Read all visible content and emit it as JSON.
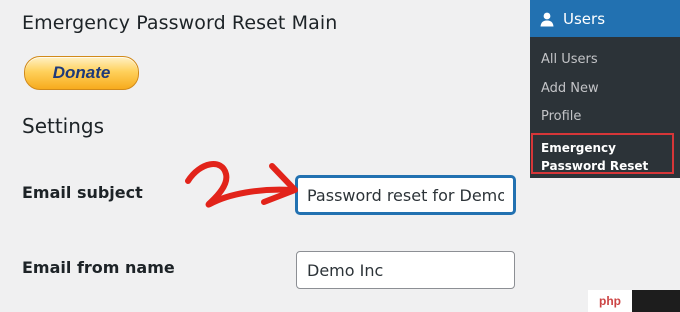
{
  "page": {
    "title": "Emergency Password Reset Main",
    "donate_label": "Donate",
    "settings_heading": "Settings"
  },
  "fields": {
    "email_subject": {
      "label": "Email subject",
      "value": "Password reset for Demo"
    },
    "email_from_name": {
      "label": "Email from name",
      "value": "Demo Inc"
    }
  },
  "sidebar": {
    "menu_title": "Users",
    "menu_icon": "user-icon",
    "items": [
      {
        "label": "All Users"
      },
      {
        "label": "Add New"
      },
      {
        "label": "Profile"
      },
      {
        "label": "Emergency Password Reset",
        "active": true
      }
    ]
  },
  "annotation": {
    "arrow_color": "#e2231a",
    "highlight_color": "#d63638"
  },
  "watermark": {
    "text": "php"
  },
  "colors": {
    "accent": "#2271b1",
    "sidebar_bg": "#1d2327",
    "submenu_bg": "#2c3338",
    "page_bg": "#f0f0f1"
  }
}
